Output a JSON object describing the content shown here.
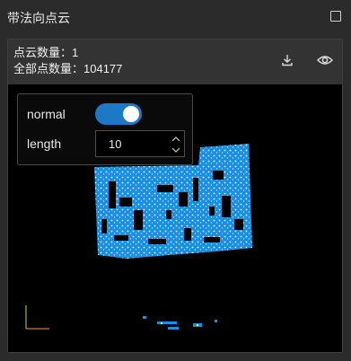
{
  "window": {
    "title": "带法向点云"
  },
  "panel": {
    "count_line": "点云数量：1",
    "total_line": "全部点数量：104177"
  },
  "controls": {
    "normal_label": "normal",
    "normal_enabled": true,
    "length_label": "length",
    "length_value": "10"
  },
  "colors": {
    "accent": "#1e78c8",
    "points": "#1a8fe0"
  },
  "icons": {
    "maximize": "square-outline-icon",
    "download": "download-icon",
    "visibility": "eye-icon",
    "axes": "axes-gizmo-icon"
  }
}
